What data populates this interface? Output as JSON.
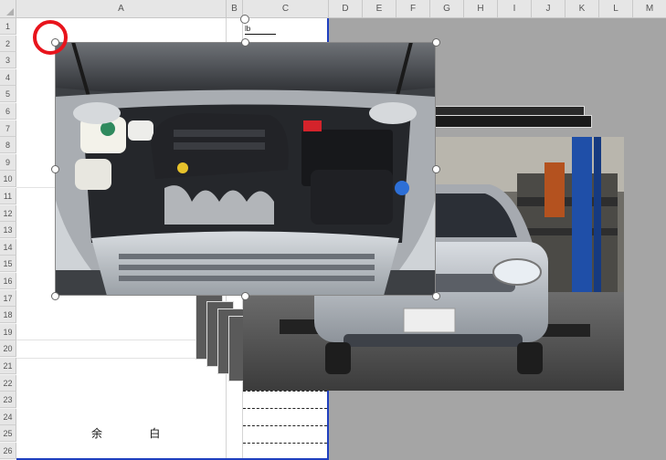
{
  "spreadsheet": {
    "columns": [
      "A",
      "B",
      "C",
      "D",
      "E",
      "F",
      "G",
      "H",
      "I",
      "J",
      "K",
      "L",
      "M"
    ],
    "rows": [
      "1",
      "2",
      "3",
      "4",
      "5",
      "6",
      "7",
      "8",
      "9",
      "10",
      "11",
      "12",
      "13",
      "14",
      "15",
      "16",
      "17",
      "18",
      "19",
      "20",
      "21",
      "22",
      "23",
      "24",
      "25",
      "26"
    ],
    "memo_text": "余 白",
    "small_cell_text": "lb"
  },
  "images": {
    "engine_photo": "engine-bay-photo",
    "garage_photo": "silver-car-in-garage-photo"
  },
  "colors": {
    "print_area_border": "#1f3fbf",
    "highlight_circle": "#e8141c",
    "outside_print_area": "#a5a5a5"
  }
}
